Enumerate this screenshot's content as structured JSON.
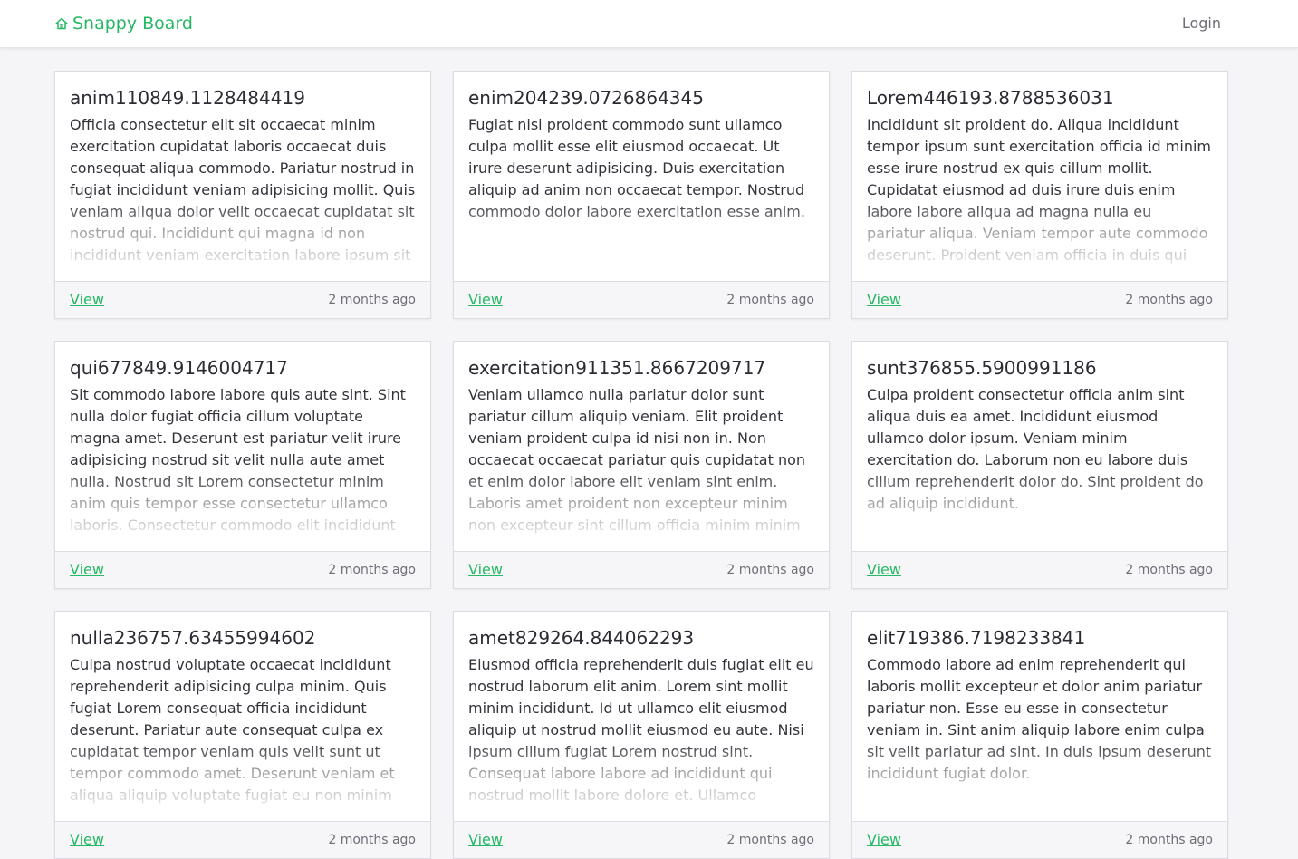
{
  "colors": {
    "brand": "#27b865",
    "background": "#f5f5f8",
    "card_footer": "#f6f6f8"
  },
  "navbar": {
    "brand_icon": "home-icon",
    "brand_text": "Snappy Board",
    "login_label": "Login"
  },
  "cards": [
    {
      "title": "anim110849.1128484419",
      "body": "Officia consectetur elit sit occaecat minim exercitation cupidatat laboris occaecat duis consequat aliqua commodo. Pariatur nostrud in fugiat incididunt veniam adipisicing mollit. Quis veniam aliqua dolor velit occaecat cupidatat sit nostrud qui. Incididunt qui magna id non incididunt veniam exercitation labore ipsum sit",
      "view_label": "View",
      "timestamp": "2 months ago"
    },
    {
      "title": "enim204239.0726864345",
      "body": "Fugiat nisi proident commodo sunt ullamco culpa mollit esse elit eiusmod occaecat. Ut irure deserunt adipisicing. Duis exercitation aliquip ad anim non occaecat tempor. Nostrud commodo dolor labore exercitation esse anim.",
      "view_label": "View",
      "timestamp": "2 months ago"
    },
    {
      "title": "Lorem446193.8788536031",
      "body": "Incididunt sit proident do. Aliqua incididunt tempor ipsum sunt exercitation officia id minim esse irure nostrud ex quis cillum mollit. Cupidatat eiusmod ad duis irure duis enim labore labore aliqua ad magna nulla eu pariatur aliqua. Veniam tempor aute commodo deserunt. Proident veniam officia in duis qui",
      "view_label": "View",
      "timestamp": "2 months ago"
    },
    {
      "title": "qui677849.9146004717",
      "body": "Sit commodo labore labore quis aute sint. Sint nulla dolor fugiat officia cillum voluptate magna amet. Deserunt est pariatur velit irure adipisicing nostrud sit velit nulla aute amet nulla. Nostrud sit Lorem consectetur minim anim quis tempor esse consectetur ullamco laboris. Consectetur commodo elit incididunt",
      "view_label": "View",
      "timestamp": "2 months ago"
    },
    {
      "title": "exercitation911351.8667209717",
      "body": "Veniam ullamco nulla pariatur dolor sunt pariatur cillum aliquip veniam. Elit proident veniam proident culpa id nisi non in. Non occaecat occaecat pariatur quis cupidatat non et enim dolor labore elit veniam sint enim. Laboris amet proident non excepteur minim non excepteur sint cillum officia minim minim",
      "view_label": "View",
      "timestamp": "2 months ago"
    },
    {
      "title": "sunt376855.5900991186",
      "body": "Culpa proident consectetur officia anim sint aliqua duis ea amet. Incididunt eiusmod ullamco dolor ipsum. Veniam minim exercitation do. Laborum non eu labore duis cillum reprehenderit dolor do. Sint proident do ad aliquip incididunt.",
      "view_label": "View",
      "timestamp": "2 months ago"
    },
    {
      "title": "nulla236757.63455994602",
      "body": "Culpa nostrud voluptate occaecat incididunt reprehenderit adipisicing culpa minim. Quis fugiat Lorem consequat officia incididunt deserunt. Pariatur aute consequat culpa ex cupidatat tempor veniam quis velit sunt ut tempor commodo amet. Deserunt veniam et aliqua aliquip voluptate fugiat eu non minim",
      "view_label": "View",
      "timestamp": "2 months ago"
    },
    {
      "title": "amet829264.844062293",
      "body": "Eiusmod officia reprehenderit duis fugiat elit eu nostrud laborum elit anim. Lorem sint mollit minim incididunt. Id ut ullamco elit eiusmod aliquip ut nostrud mollit eiusmod eu aute. Nisi ipsum cillum fugiat Lorem nostrud sint. Consequat labore labore ad incididunt qui nostrud mollit labore dolore et. Ullamco",
      "view_label": "View",
      "timestamp": "2 months ago"
    },
    {
      "title": "elit719386.7198233841",
      "body": "Commodo labore ad enim reprehenderit qui laboris mollit excepteur et dolor anim pariatur pariatur non. Esse eu esse in consectetur veniam in. Sint anim aliquip labore enim culpa sit velit pariatur ad sint. In duis ipsum deserunt incididunt fugiat dolor.",
      "view_label": "View",
      "timestamp": "2 months ago"
    }
  ]
}
